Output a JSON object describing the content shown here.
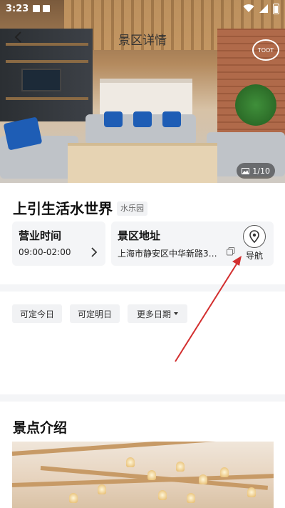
{
  "status": {
    "time": "3:23"
  },
  "header": {
    "title": "景区详情",
    "back_icon": "chevron-left-icon"
  },
  "hero": {
    "logo_text": "TOOT",
    "photo_count": "1/10"
  },
  "place": {
    "name": "上引生活水世界",
    "tag": "水乐园",
    "hours_label": "营业时间",
    "hours_value": "09:00-02:00",
    "address_label": "景区地址",
    "address_value": "上海市静安区中华新路3…",
    "navigate_label": "导航"
  },
  "dates": {
    "today": "可定今日",
    "tomorrow": "可定明日",
    "more": "更多日期"
  },
  "intro": {
    "title": "景点介绍"
  },
  "colors": {
    "accent": "#1e5db5",
    "annotation": "#d32f2f"
  }
}
